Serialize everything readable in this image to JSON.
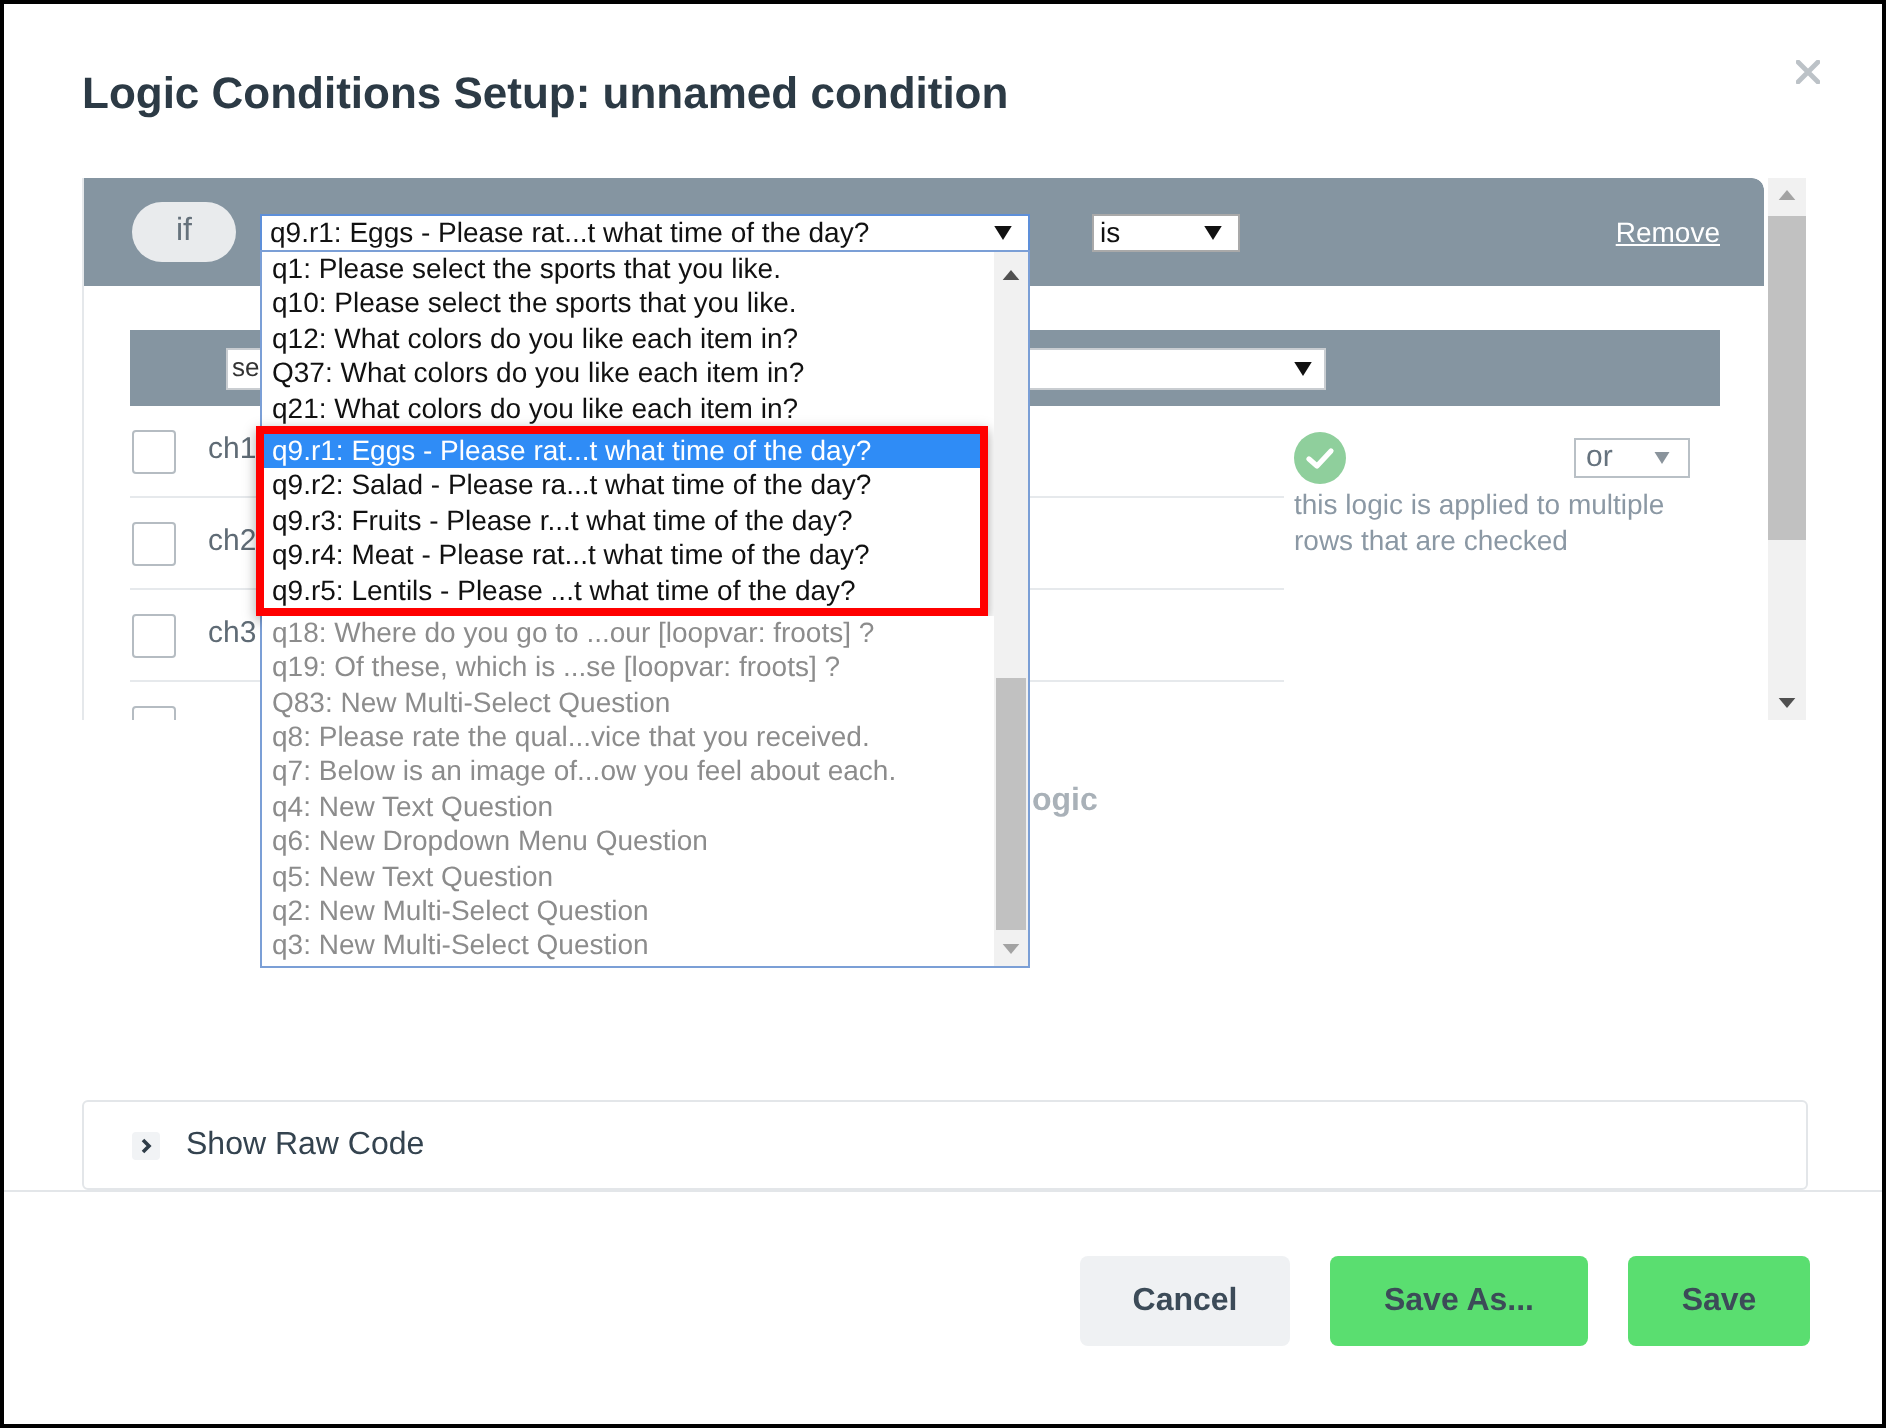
{
  "dialog": {
    "title": "Logic Conditions Setup: unnamed condition"
  },
  "condition": {
    "if_label": "if",
    "question_select": {
      "value": "q9.r1: Eggs - Please rat...t what time of the day?",
      "focused": true
    },
    "operator_select": {
      "value": "is"
    },
    "remove_link": "Remove"
  },
  "answer_select": {
    "value": "se"
  },
  "choices": [
    {
      "label": "ch1",
      "checked": false
    },
    {
      "label": "ch2",
      "checked": false
    },
    {
      "label": "ch3",
      "checked": false
    },
    {
      "checked": false
    }
  ],
  "combine": {
    "value": "or",
    "note": "this logic is applied to multiple rows that are checked"
  },
  "label_fragment": "ogic",
  "question_option_groups": [
    {
      "highlighted": false,
      "options": [
        {
          "label": "q1: Please select the sports that you like.",
          "selected": false,
          "disabled": false
        },
        {
          "label": "q10: Please select the sports that you like.",
          "selected": false,
          "disabled": false
        },
        {
          "label": "q12: What colors do you like each item in?",
          "selected": false,
          "disabled": false
        },
        {
          "label": "Q37: What colors do you like each item in?",
          "selected": false,
          "disabled": false
        },
        {
          "label": "q21: What colors do you like each item in?",
          "selected": false,
          "disabled": false
        }
      ]
    },
    {
      "highlighted": true,
      "options": [
        {
          "label": "q9.r1: Eggs - Please rat...t what time of the day?",
          "selected": true,
          "disabled": false
        },
        {
          "label": "q9.r2: Salad - Please ra...t what time of the day?",
          "selected": false,
          "disabled": false
        },
        {
          "label": "q9.r3: Fruits - Please r...t what time of the day?",
          "selected": false,
          "disabled": false
        },
        {
          "label": "q9.r4: Meat - Please rat...t what time of the day?",
          "selected": false,
          "disabled": false
        },
        {
          "label": "q9.r5: Lentils - Please ...t what time of the day?",
          "selected": false,
          "disabled": false
        }
      ]
    },
    {
      "highlighted": false,
      "options": [
        {
          "label": "q18: Where do you go to ...our [loopvar: froots] ?",
          "selected": false,
          "disabled": true
        },
        {
          "label": "q19: Of these, which is ...se [loopvar: froots] ?",
          "selected": false,
          "disabled": true
        },
        {
          "label": "Q83: New Multi-Select Question",
          "selected": false,
          "disabled": true
        },
        {
          "label": "q8: Please rate the qual...vice that you received.",
          "selected": false,
          "disabled": true
        },
        {
          "label": "q7: Below is an image of...ow you feel about each.",
          "selected": false,
          "disabled": true
        },
        {
          "label": "q4: New Text Question",
          "selected": false,
          "disabled": true
        },
        {
          "label": "q6: New Dropdown Menu Question",
          "selected": false,
          "disabled": true
        },
        {
          "label": "q5: New Text Question",
          "selected": false,
          "disabled": true
        },
        {
          "label": "q2: New Multi-Select Question",
          "selected": false,
          "disabled": true
        },
        {
          "label": "q3: New Multi-Select Question",
          "selected": false,
          "disabled": true
        }
      ]
    }
  ],
  "raw_code": {
    "label": "Show Raw Code",
    "expanded": false
  },
  "buttons": [
    {
      "label": "Cancel",
      "kind": "secondary"
    },
    {
      "label": "Save As...",
      "kind": "primary"
    },
    {
      "label": "Save",
      "kind": "primary"
    }
  ]
}
